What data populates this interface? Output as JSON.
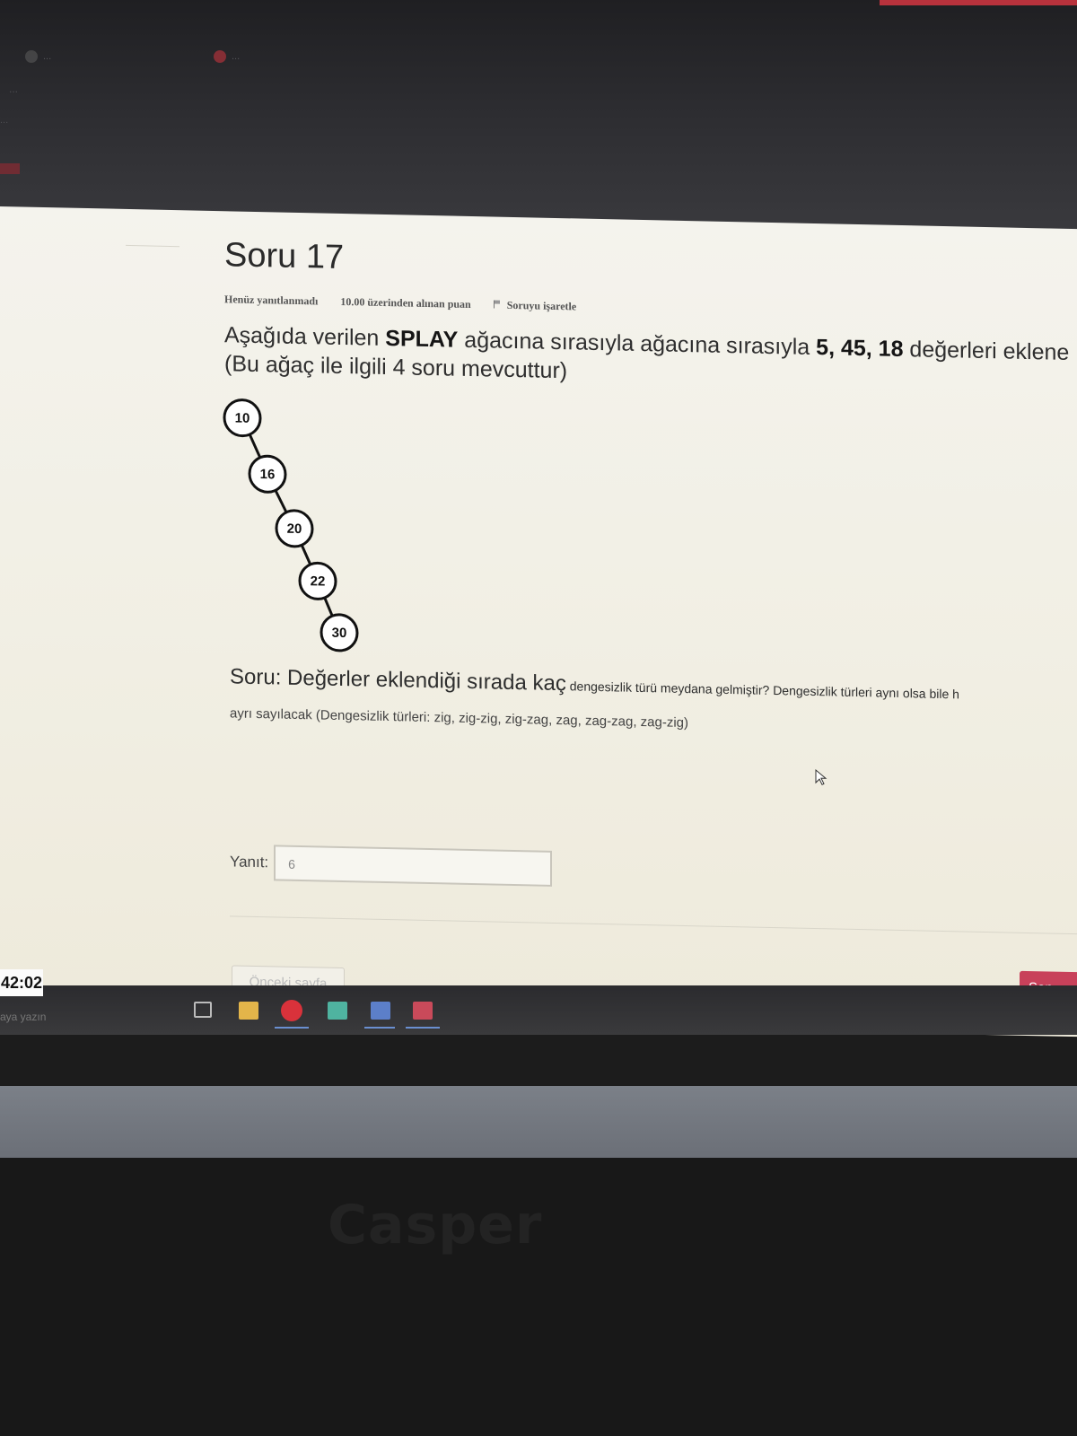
{
  "browser": {
    "tabs": [
      "...",
      "..."
    ],
    "url": "...",
    "bookmarks": "..."
  },
  "question": {
    "title": "Soru 17",
    "status": "Henüz yanıtlanmadı",
    "points": "10.00 üzerinden alınan puan",
    "flag_label": "Soruyu işaretle",
    "text_prefix": "Aşağıda verilen ",
    "text_splay": "SPLAY",
    "text_mid": " ağacına sırasıyla ağacına sırasıyla ",
    "text_values": "5, 45, 18",
    "text_suffix": " değerleri eklene",
    "note": "(Bu ağaç ile ilgili 4 soru mevcuttur)"
  },
  "tree": {
    "nodes": [
      "10",
      "16",
      "20",
      "22",
      "30"
    ]
  },
  "sub_question": {
    "lead": "Soru: Değerler eklendiği sırada kaç",
    "small": " dengesizlik türü meydana gelmiştir? Dengesizlik türleri aynı olsa bile h",
    "line2": "ayrı sayılacak (Dengesizlik türleri: zig, zig-zig, zig-zag, zag, zag-zag, zag-zig)"
  },
  "answer": {
    "label": "Yanıt:",
    "value": "6"
  },
  "nav": {
    "prev": "Önceki sayfa",
    "next": "Son"
  },
  "taskbar": {
    "clock": "42:02",
    "search_hint": "aya yazın"
  },
  "device": {
    "brand": "Casper"
  }
}
